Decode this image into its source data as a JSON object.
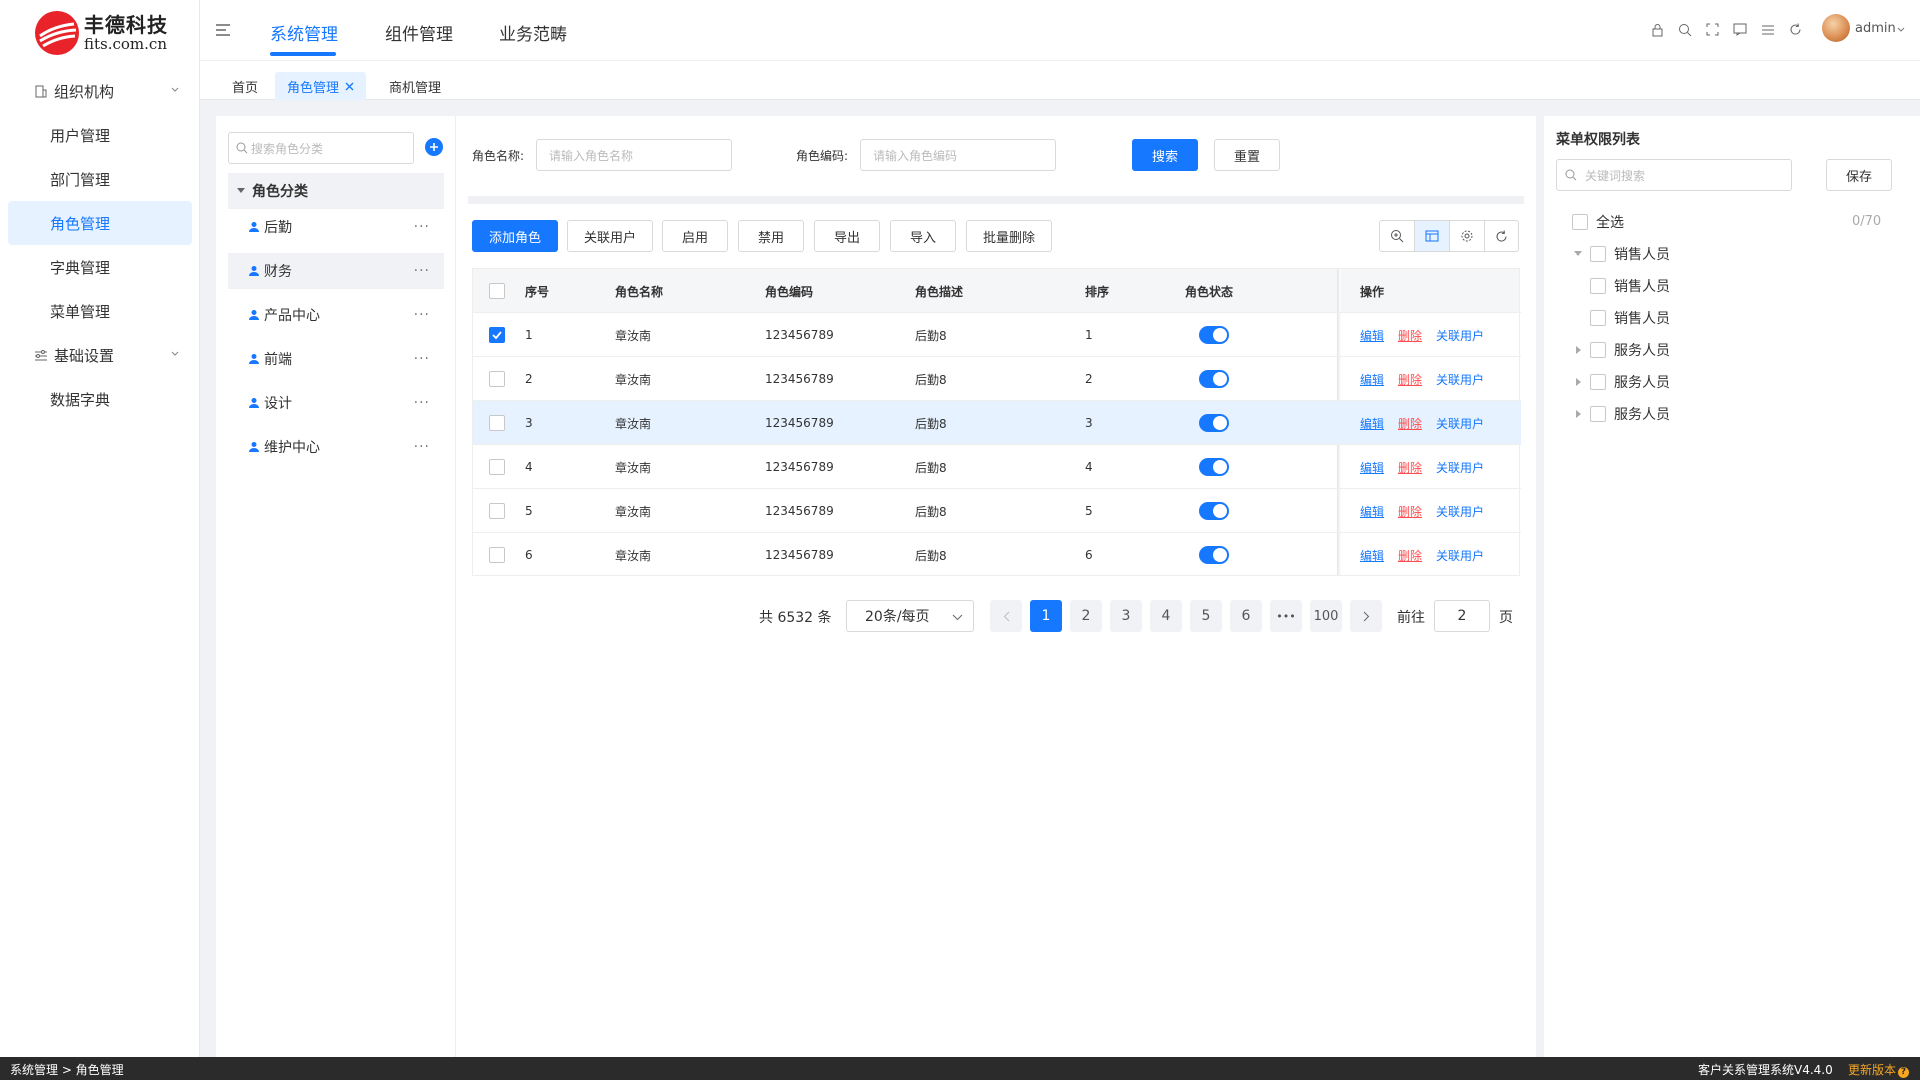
{
  "logo": {
    "name": "丰德科技",
    "domain": "fits.com.cn"
  },
  "sidebar": {
    "items": [
      {
        "label": "组织机构",
        "type": "group"
      },
      {
        "label": "用户管理"
      },
      {
        "label": "部门管理"
      },
      {
        "label": "角色管理",
        "active": true
      },
      {
        "label": "字典管理"
      },
      {
        "label": "菜单管理"
      },
      {
        "label": "基础设置",
        "type": "group"
      },
      {
        "label": "数据字典"
      }
    ]
  },
  "topnav": {
    "items": [
      "系统管理",
      "组件管理",
      "业务范畴"
    ],
    "active": "系统管理",
    "user": "admin"
  },
  "tabs": [
    {
      "label": "首页"
    },
    {
      "label": "角色管理",
      "active": true,
      "closable": true
    },
    {
      "label": "商机管理"
    }
  ],
  "category": {
    "search_placeholder": "搜索角色分类",
    "root": "角色分类",
    "items": [
      "后勤",
      "财务",
      "产品中心",
      "前端",
      "设计",
      "维护中心"
    ],
    "active": "财务"
  },
  "filters": {
    "name_label": "角色名称:",
    "name_placeholder": "请输入角色名称",
    "code_label": "角色编码:",
    "code_placeholder": "请输入角色编码",
    "search": "搜索",
    "reset": "重置"
  },
  "toolbar": [
    "添加角色",
    "关联用户",
    "启用",
    "禁用",
    "导出",
    "导入",
    "批量删除"
  ],
  "table": {
    "headers": [
      "序号",
      "角色名称",
      "角色编码",
      "角色描述",
      "排序",
      "角色状态",
      "操作"
    ],
    "rows": [
      {
        "no": "1",
        "name": "章汝南",
        "code": "123456789",
        "desc": "后勤8",
        "sort": "1",
        "checked": true,
        "enabled": true
      },
      {
        "no": "2",
        "name": "章汝南",
        "code": "123456789",
        "desc": "后勤8",
        "sort": "2",
        "checked": false,
        "enabled": true
      },
      {
        "no": "3",
        "name": "章汝南",
        "code": "123456789",
        "desc": "后勤8",
        "sort": "3",
        "checked": false,
        "enabled": true,
        "highlight": true
      },
      {
        "no": "4",
        "name": "章汝南",
        "code": "123456789",
        "desc": "后勤8",
        "sort": "4",
        "checked": false,
        "enabled": true
      },
      {
        "no": "5",
        "name": "章汝南",
        "code": "123456789",
        "desc": "后勤8",
        "sort": "5",
        "checked": false,
        "enabled": true
      },
      {
        "no": "6",
        "name": "章汝南",
        "code": "123456789",
        "desc": "后勤8",
        "sort": "6",
        "checked": false,
        "enabled": true
      }
    ],
    "actions": [
      "编辑",
      "删除",
      "关联用户"
    ]
  },
  "pagination": {
    "total": "共 6532 条",
    "page_size": "20条/每页",
    "pages": [
      "1",
      "2",
      "3",
      "4",
      "5",
      "6",
      "•••",
      "100"
    ],
    "current": "1",
    "goto_label": "前往",
    "goto_value": "2",
    "page_suffix": "页"
  },
  "permissions": {
    "title": "菜单权限列表",
    "search_placeholder": "关键词搜索",
    "save": "保存",
    "select_all": "全选",
    "count": "0/70",
    "tree": [
      {
        "label": "销售人员",
        "level": 0,
        "expanded": true
      },
      {
        "label": "销售人员",
        "level": 1
      },
      {
        "label": "销售人员",
        "level": 1
      },
      {
        "label": "服务人员",
        "level": 0,
        "expanded": false
      },
      {
        "label": "服务人员",
        "level": 0,
        "expanded": false
      },
      {
        "label": "服务人员",
        "level": 0,
        "expanded": false
      }
    ]
  },
  "statusbar": {
    "breadcrumb": "系统管理 > 角色管理",
    "version": "客户关系管理系统V4.4.0",
    "update": "更新版本"
  },
  "colors": {
    "primary": "#1677ff",
    "danger": "#ff4d4f",
    "warning": "#f5a623",
    "active_bg": "#e6f2ff"
  }
}
